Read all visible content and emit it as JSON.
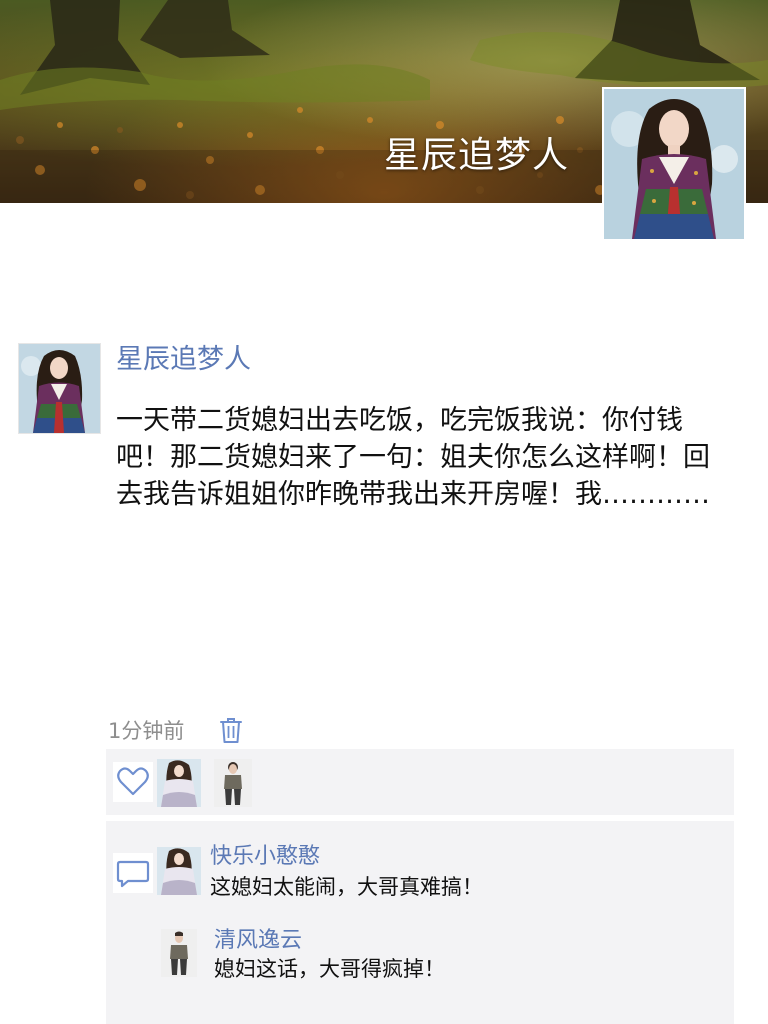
{
  "cover": {
    "title": "星辰追梦人"
  },
  "post": {
    "author": "星辰追梦人",
    "text": "一天带二货媳妇出去吃饭，吃完饭我说：你付钱吧！那二货媳妇来了一句：姐夫你怎么这样啊！回去我告诉姐姐你昨晚带我出来开房喔！我…………",
    "time": "1分钟前"
  },
  "likes": {
    "users": [
      "like-avatar-girl",
      "like-avatar-man"
    ]
  },
  "comments": [
    {
      "author": "快乐小憨憨",
      "text": "这媳妇太能闹，大哥真难搞！"
    },
    {
      "author": "清风逸云",
      "text": "媳妇这话，大哥得疯掉！"
    }
  ],
  "colors": {
    "link": "#5b79b5",
    "panel": "#f3f3f5",
    "icon": "#6f8fd0"
  },
  "icons": [
    "trash-icon",
    "heart-icon",
    "comment-icon"
  ]
}
